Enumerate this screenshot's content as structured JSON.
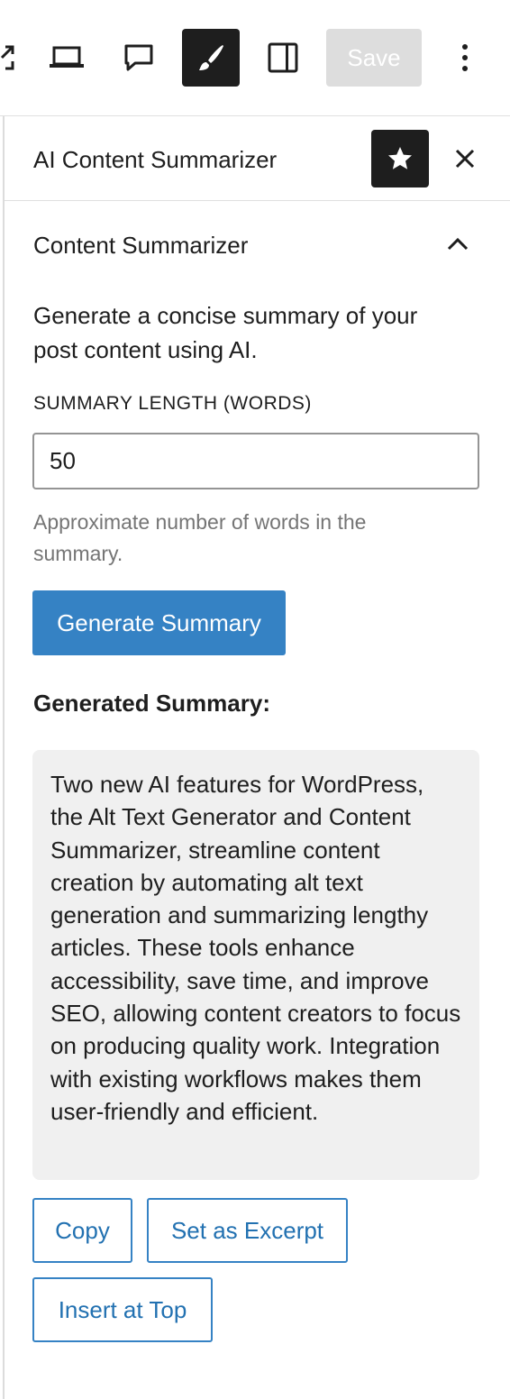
{
  "toolbar": {
    "icons": [
      "external-link-icon",
      "desktop-preview-icon",
      "comment-icon",
      "brush-icon",
      "sidebar-toggle-icon",
      "more-vertical-icon"
    ],
    "save_label": "Save"
  },
  "panel": {
    "title": "AI Content Summarizer",
    "pin_icon": "star-icon",
    "close_icon": "close-icon"
  },
  "section": {
    "title": "Content Summarizer",
    "toggle_icon": "chevron-up-icon",
    "description": "Generate a concise summary of your post content using AI.",
    "length_label": "SUMMARY LENGTH (WORDS)",
    "length_value": "50",
    "length_help": "Approximate number of words in the summary.",
    "generate_label": "Generate Summary",
    "generated_heading": "Generated Summary:",
    "summary_text": "Two new AI features for WordPress, the Alt Text Generator and Content Summarizer, streamline content creation by automating alt text generation and summarizing lengthy articles. These tools enhance accessibility, save time, and improve SEO, allowing content creators to focus on producing quality work. Integration with existing workflows makes them user-friendly and efficient.",
    "actions": {
      "copy": "Copy",
      "excerpt": "Set as Excerpt",
      "insert_top": "Insert at Top"
    }
  },
  "colors": {
    "accent": "#3582c4",
    "accent_text": "#2271b1",
    "dark": "#1e1e1e",
    "summary_bg": "#f0f0f0",
    "disabled": "#dddddd",
    "help_text": "#757575"
  }
}
